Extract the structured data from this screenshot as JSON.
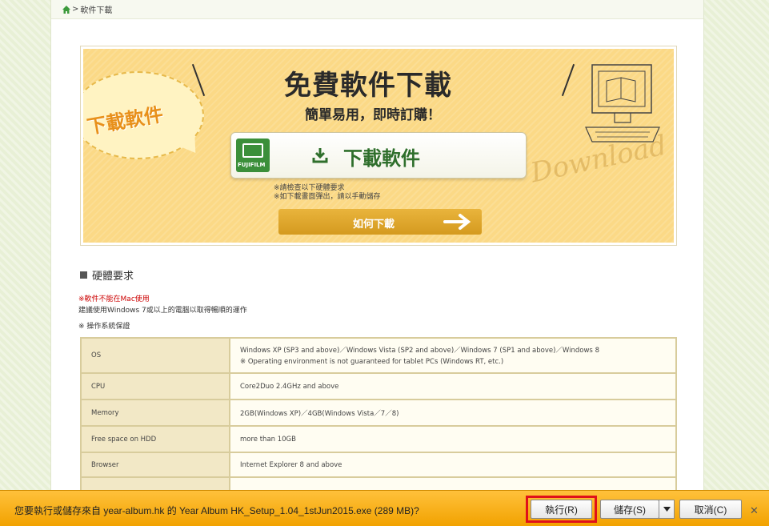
{
  "breadcrumb": {
    "sep": ">",
    "current": "軟件下載"
  },
  "banner": {
    "title": "免費軟件下載",
    "subtitle": "簡單易用，即時訂購！",
    "bubble_text": "下載軟件",
    "download_button": "下載軟件",
    "logo_text": "FUJIFILM",
    "note1": "※請檢查以下硬體要求",
    "note2": "※如下載畫面彈出，請以手動儲存",
    "howto_button": "如何下載",
    "decor_text": "Download"
  },
  "hardware": {
    "heading": "硬體要求",
    "warning": "※軟件不能在Mac使用",
    "recommend": "建議使用Windows 7或以上的電腦以取得暢順的運作",
    "os_note": "※ 操作系統保證",
    "rows": [
      {
        "key": "OS",
        "value": "Windows XP (SP3 and above)／Windows Vista (SP2 and above)／Windows 7 (SP1 and above)／Windows 8",
        "value2": "※ Operating environment is not guaranteed for tablet PCs (Windows RT, etc.)"
      },
      {
        "key": "CPU",
        "value": "Core2Duo 2.4GHz and above"
      },
      {
        "key": "Memory",
        "value": "2GB(Windows XP)／4GB(Windows Vista／7／8)"
      },
      {
        "key": "Free space on HDD",
        "value": "more than 10GB"
      },
      {
        "key": "Browser",
        "value": "Internet Explorer 8 and above"
      },
      {
        "key": "",
        "value": ""
      }
    ]
  },
  "download_bar": {
    "message": "您要執行或儲存來自 year-album.hk 的 Year Album HK_Setup_1.04_1stJun2015.exe (289 MB)?",
    "run_label": "執行(R)",
    "save_label": "儲存(S)",
    "cancel_label": "取消(C)",
    "close_glyph": "✕"
  }
}
